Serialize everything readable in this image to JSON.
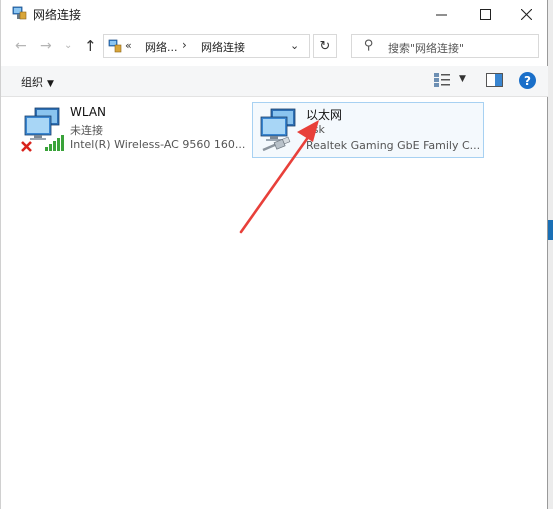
{
  "window": {
    "title": "网络连接",
    "controls": {
      "minimize": "—",
      "maximize": "☐",
      "close": "✕"
    }
  },
  "nav": {
    "back": "←",
    "forward": "→",
    "recent": "⌄",
    "up": "↑",
    "address": {
      "chevron": "«",
      "crumb1": "网络...",
      "separator": "›",
      "crumb2": "网络连接",
      "dropdown": "⌄"
    },
    "refresh": "↻",
    "search_placeholder": "搜索\"网络连接\""
  },
  "toolbar": {
    "organize": "组织",
    "organize_caret": "▼",
    "view_caret": "▼",
    "help": "?"
  },
  "connections": [
    {
      "name": "WLAN",
      "status": "未连接",
      "device": "Intel(R) Wireless-AC 9560 160...",
      "icon": "wireless-network-icon",
      "selected": false
    },
    {
      "name": "以太网",
      "status": "esk",
      "device": "Realtek Gaming GbE Family C...",
      "icon": "ethernet-network-icon",
      "selected": true
    }
  ],
  "colors": {
    "selection_border": "#a7d1f2",
    "selection_bg": "#f4f9fd",
    "annotation_arrow": "#e8403a",
    "help_blue": "#1a6fc9"
  }
}
